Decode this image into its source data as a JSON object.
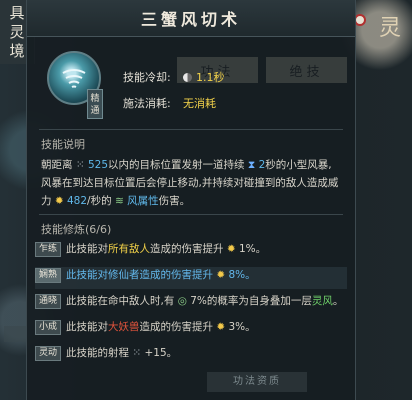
{
  "realm_tag": [
    "具",
    "灵",
    "境"
  ],
  "deco_char": "灵",
  "title": "三蟹风切术",
  "icon_badge": "精通",
  "bg_tabs": [
    "悟"
  ],
  "bg_tab_labels": [
    "功法",
    "绝技"
  ],
  "stats": {
    "cooldown_label": "技能冷却:",
    "cooldown_value": "1.1秒",
    "cost_label": "施法消耗:",
    "cost_value": "无消耗"
  },
  "description": {
    "heading": "技能说明",
    "p1": "朝距离",
    "range": "525",
    "p2": "以内的目标位置发射一道持续",
    "duration": "2",
    "p3": "秒的小型风暴,风暴在到达目标位置后会停止移动,并持续对碰撞到的敌人造成威力",
    "power": "482",
    "p4": "/秒的",
    "element": "风属性",
    "p5": "伤害。"
  },
  "cultivation": {
    "heading": "技能修炼(6/6)",
    "rows": [
      {
        "tag": "乍练",
        "a": "此技能对",
        "hl": "所有敌人",
        "b": "造成的伤害提升",
        "val": "1%。"
      },
      {
        "tag": "娴熟",
        "a": "此技能对修仙者造成的伤害提升",
        "val": "8%。"
      },
      {
        "tag": "通晓",
        "a": "此技能在命中敌人时,有",
        "chance": "7%",
        "b": "的概率为自身叠加一层",
        "hl": "灵风",
        "end": "。"
      },
      {
        "tag": "小成",
        "a": "此技能对",
        "hl": "大妖兽",
        "b": "造成的伤害提升",
        "val": "3%。"
      },
      {
        "tag": "灵动",
        "a": "此技能的射程",
        "val": "+15。"
      }
    ]
  },
  "bottom_deco": "功法资质"
}
